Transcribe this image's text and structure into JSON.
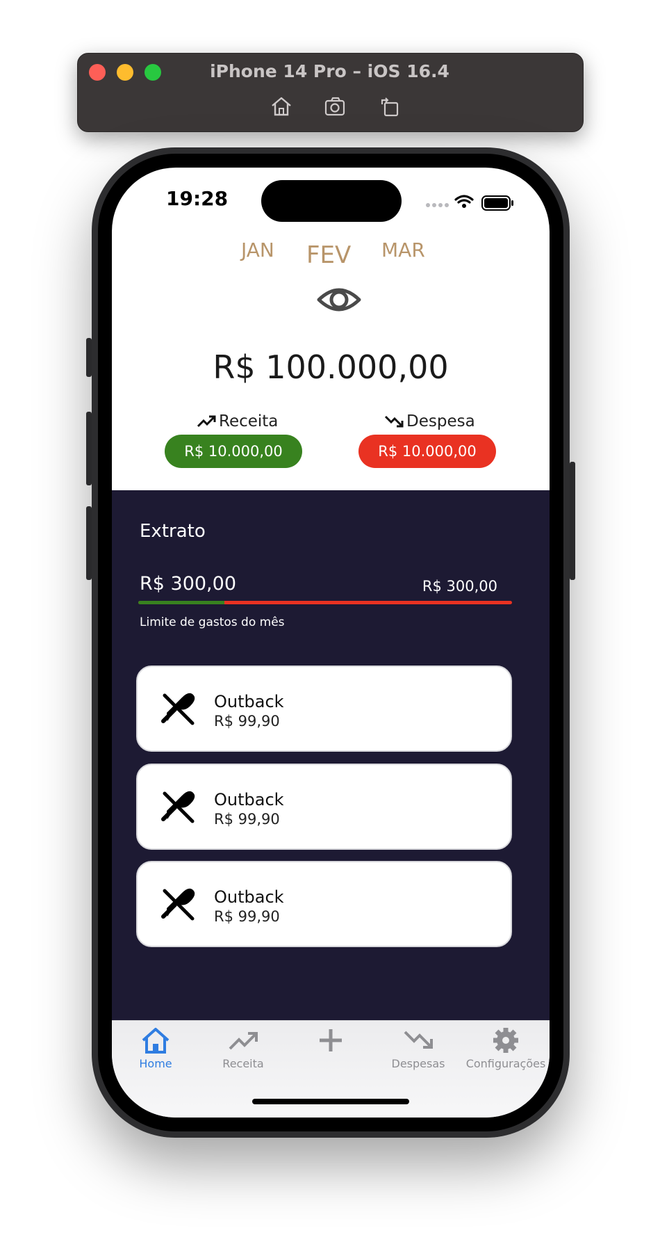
{
  "simulator": {
    "title": "iPhone 14 Pro – iOS 16.4",
    "tools": [
      "home-icon",
      "screenshot-icon",
      "rotate-icon"
    ]
  },
  "status_bar": {
    "time": "19:28"
  },
  "months": {
    "prev": "JAN",
    "current": "FEV",
    "next": "MAR"
  },
  "balance": "R$ 100.000,00",
  "income": {
    "label": "Receita",
    "amount": "R$ 10.000,00",
    "color": "#38821f"
  },
  "expense": {
    "label": "Despesa",
    "amount": "R$ 10.000,00",
    "color": "#e93222"
  },
  "statement": {
    "title": "Extrato",
    "spent": "R$ 300,00",
    "limit": "R$ 300,00",
    "progress_fraction": 0.23,
    "caption": "Limite de gastos do mês"
  },
  "transactions": [
    {
      "icon": "fork-spoon-icon",
      "title": "Outback",
      "amount": "R$ 99,90"
    },
    {
      "icon": "fork-spoon-icon",
      "title": "Outback",
      "amount": "R$ 99,90"
    },
    {
      "icon": "fork-spoon-icon",
      "title": "Outback",
      "amount": "R$ 99,90"
    }
  ],
  "tabs": [
    {
      "label": "Home",
      "icon": "home-icon",
      "active": true
    },
    {
      "label": "Receita",
      "icon": "trend-up-icon",
      "active": false
    },
    {
      "label": "",
      "icon": "plus-icon",
      "active": false
    },
    {
      "label": "Despesas",
      "icon": "trend-down-icon",
      "active": false
    },
    {
      "label": "Configurações",
      "icon": "gear-icon",
      "active": false
    }
  ],
  "colors": {
    "accent": "#2f7de1",
    "month": "#b8956a",
    "dark_bg": "#1d1a33"
  }
}
